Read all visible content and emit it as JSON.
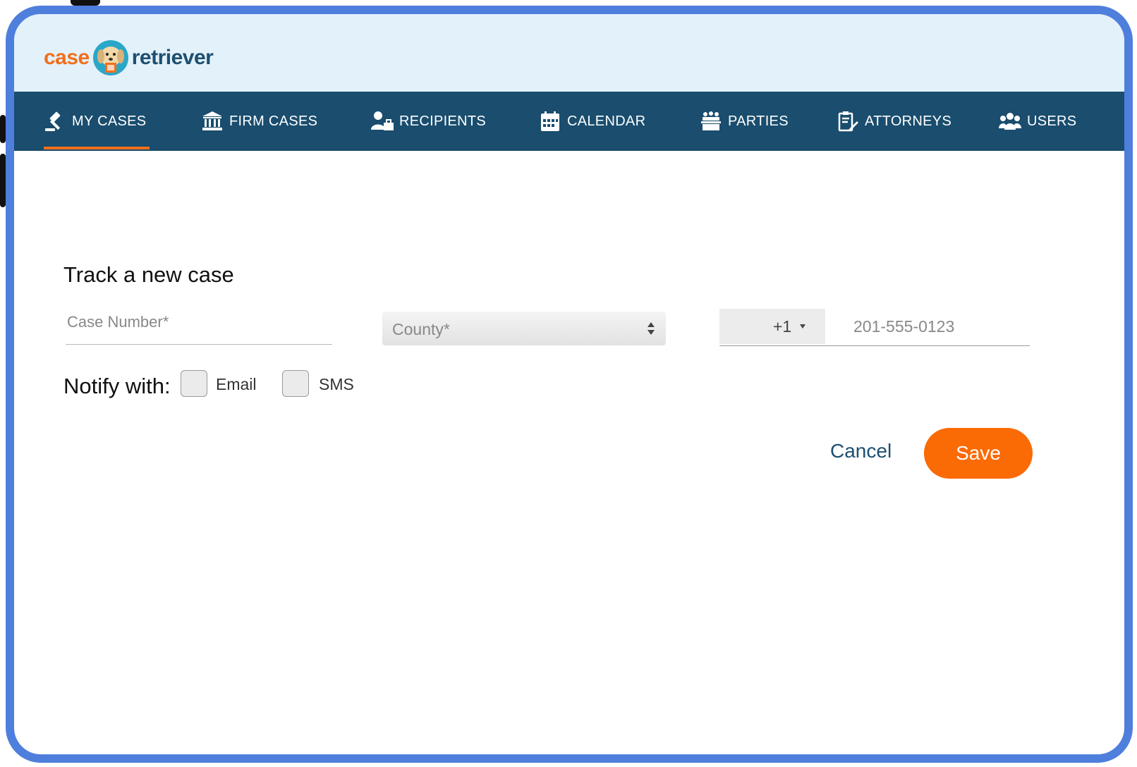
{
  "app": {
    "logo_case": "case",
    "logo_retriever": "retriever",
    "brand_orange": "#f26f1b",
    "brand_navy": "#1a4d6e"
  },
  "nav": {
    "items": [
      {
        "label": "MY CASES",
        "icon": "gavel-icon",
        "active": true
      },
      {
        "label": "FIRM CASES",
        "icon": "bank-icon",
        "active": false
      },
      {
        "label": "RECIPIENTS",
        "icon": "recipient-icon",
        "active": false
      },
      {
        "label": "CALENDAR",
        "icon": "calendar-icon",
        "active": false
      },
      {
        "label": "PARTIES",
        "icon": "courtroom-icon",
        "active": false
      },
      {
        "label": "ATTORNEYS",
        "icon": "clipboard-edit-icon",
        "active": false
      },
      {
        "label": "USERS",
        "icon": "users-icon",
        "active": false
      }
    ]
  },
  "form": {
    "title": "Track a new case",
    "case_number_placeholder": "Case Number*",
    "county_placeholder": "County*",
    "country_code": "+1",
    "phone_placeholder": "201-555-0123",
    "notify_label": "Notify with:",
    "email_label": "Email",
    "sms_label": "SMS",
    "email_checked": false,
    "sms_checked": false
  },
  "actions": {
    "cancel_label": "Cancel",
    "save_label": "Save"
  }
}
